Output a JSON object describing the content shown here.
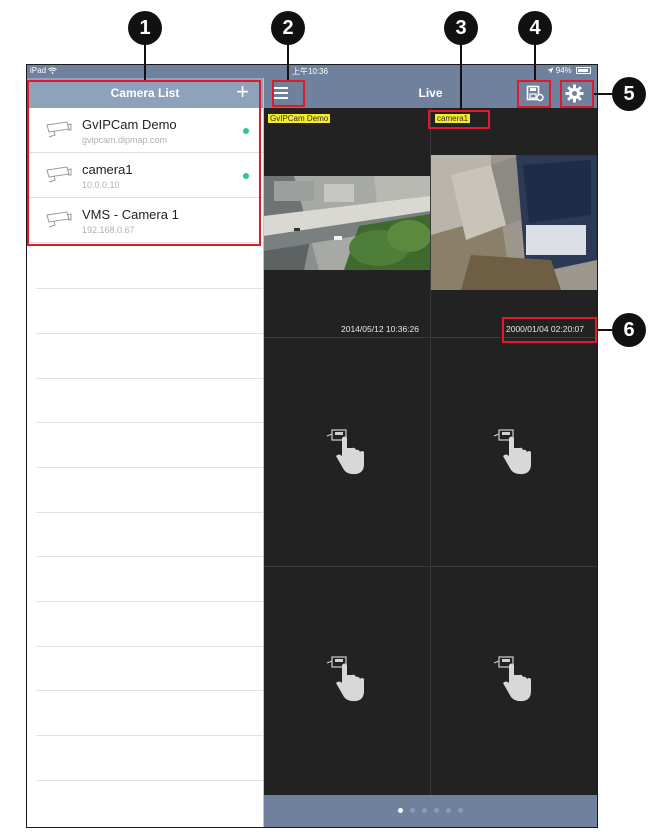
{
  "status_bar": {
    "device": "iPad",
    "time": "上午10:36",
    "battery": "94%"
  },
  "left_panel": {
    "title": "Camera List",
    "add_label": "+",
    "cameras": [
      {
        "name": "GvIPCam Demo",
        "address": "gvipcam.dipmap.com",
        "online": true
      },
      {
        "name": "camera1",
        "address": "10.0.0.10",
        "online": true
      },
      {
        "name": "VMS - Camera 1",
        "address": "192.168.0.67",
        "online": false
      }
    ]
  },
  "right_panel": {
    "title": "Live",
    "tiles": [
      {
        "label": "GvIPCam Demo",
        "timestamp": "2014/05/12 10:36:26"
      },
      {
        "label": "camera1",
        "timestamp": "2000/01/04 02:20:07"
      }
    ],
    "page_count": 6,
    "current_page": 1
  },
  "callouts": [
    "1",
    "2",
    "3",
    "4",
    "5",
    "6"
  ],
  "colors": {
    "nav_bar": "#6f819c",
    "left_nav_bar": "#8fa2bb",
    "online_dot": "#2bc4a0",
    "callout_box": "#e0192d",
    "tag_bg": "#f7ea2a"
  }
}
